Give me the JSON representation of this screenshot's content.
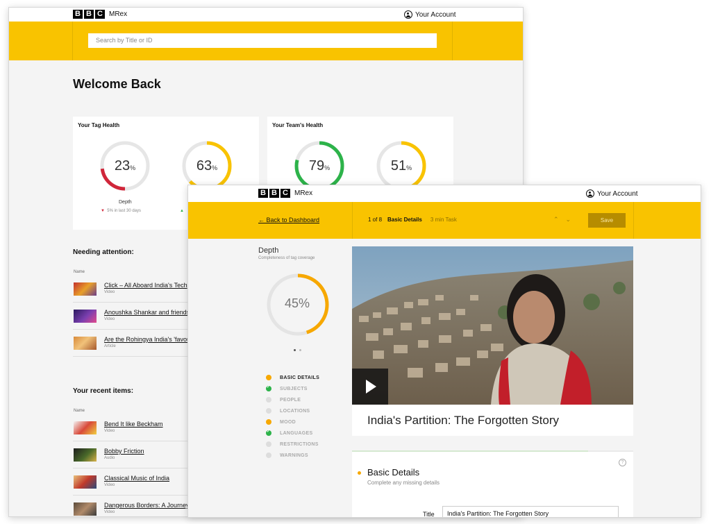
{
  "brand": {
    "logo": [
      "B",
      "B",
      "C"
    ],
    "product": "MRex"
  },
  "dashboard": {
    "account_label": "Your Account",
    "search_placeholder": "Search by Title or ID",
    "welcome": "Welcome Back",
    "tag_health": {
      "title": "Your Tag Health",
      "rings": [
        {
          "value": 23,
          "unit": "%",
          "label": "Depth",
          "trend": "5% in last 30 days",
          "trend_dir": "down",
          "color": "#d0263a"
        },
        {
          "value": 63,
          "unit": "%",
          "trend_dir": "up",
          "color": "#f9c300"
        }
      ]
    },
    "team_health": {
      "title": "Your Team's Health",
      "rings": [
        {
          "value": 79,
          "unit": "%",
          "color": "#2db34a"
        },
        {
          "value": 51,
          "unit": "%",
          "color": "#f9c300"
        }
      ]
    },
    "needing_attention": {
      "title": "Needing attention:",
      "column": "Name",
      "items": [
        {
          "title": "Click – All Aboard India's Tech",
          "type": "Video"
        },
        {
          "title": "Anoushka Shankar and friends",
          "type": "Video"
        },
        {
          "title": "Are the Rohingya India's 'favou",
          "type": "Article"
        }
      ]
    },
    "recent": {
      "title": "Your recent items:",
      "column": "Name",
      "items": [
        {
          "title": "Bend It like Beckham",
          "type": "Video"
        },
        {
          "title": "Bobby Friction",
          "type": "Audio"
        },
        {
          "title": "Classical Music of India",
          "type": "Video"
        },
        {
          "title": "Dangerous Borders: A Journey",
          "type": "Video"
        }
      ]
    }
  },
  "task": {
    "account_label": "Your Account",
    "back_link": "← Back to Dashboard",
    "position": "1 of 8",
    "step_name": "Basic Details",
    "duration": "3 min Task",
    "prev_icon": "chevron-up-icon",
    "next_icon": "chevron-down-icon",
    "save_label": "Save",
    "depth": {
      "title": "Depth",
      "subtitle": "Completeness of tag coverage",
      "value": 45,
      "display": "45%",
      "color": "#f7a800"
    },
    "steps": [
      {
        "label": "BASIC DETAILS",
        "status": "orange",
        "active": true
      },
      {
        "label": "SUBJECTS",
        "status": "green"
      },
      {
        "label": "PEOPLE",
        "status": "grey"
      },
      {
        "label": "LOCATIONS",
        "status": "grey"
      },
      {
        "label": "MOOD",
        "status": "orange"
      },
      {
        "label": "LANGUAGES",
        "status": "green"
      },
      {
        "label": "RESTRICTIONS",
        "status": "grey"
      },
      {
        "label": "WARNINGS",
        "status": "grey"
      }
    ],
    "video_title": "India's Partition: The Forgotten Story",
    "basic_details": {
      "title": "Basic Details",
      "subtitle": "Complete any missing details",
      "help_icon": "?",
      "title_label": "Title",
      "title_value": "India's Partition: The Forgotten Story"
    }
  }
}
